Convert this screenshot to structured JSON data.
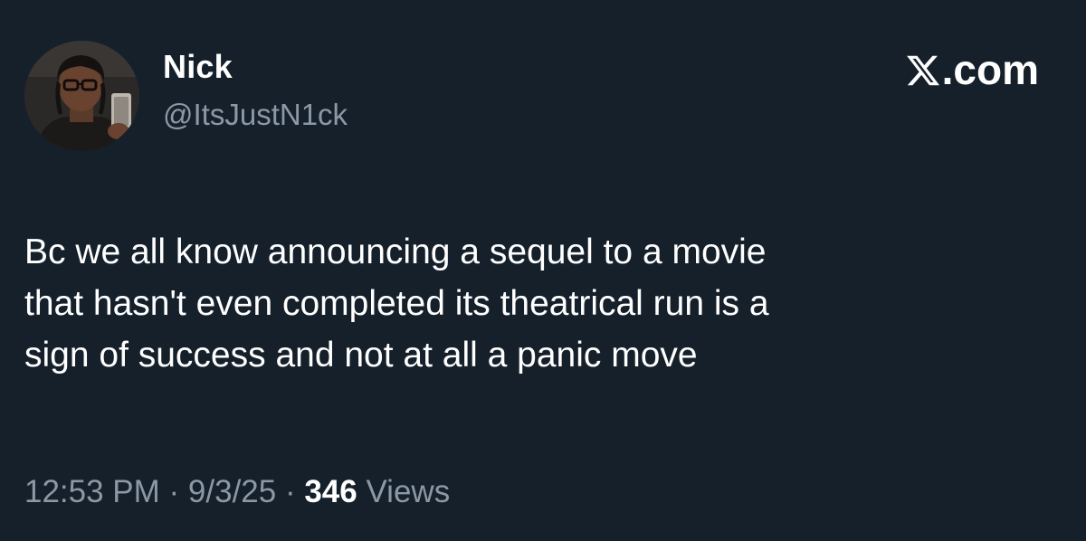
{
  "author": {
    "display_name": "Nick",
    "handle": "@ItsJustN1ck",
    "avatar_icon": "user-avatar-photo"
  },
  "brand": {
    "logo_icon": "x-logo-icon",
    "suffix": ".com"
  },
  "tweet": {
    "text": "Bc we all know announcing a sequel to a movie\nthat hasn't even completed its theatrical run is a\nsign of success and not at all a panic move"
  },
  "meta": {
    "time": "12:53 PM",
    "sep1": " · ",
    "date": "9/3/25",
    "sep2": " · ",
    "views_count": "346",
    "views_label": " Views"
  },
  "colors": {
    "background": "#15202b",
    "primary_text": "#ffffff",
    "secondary_text": "#8b98a5"
  }
}
